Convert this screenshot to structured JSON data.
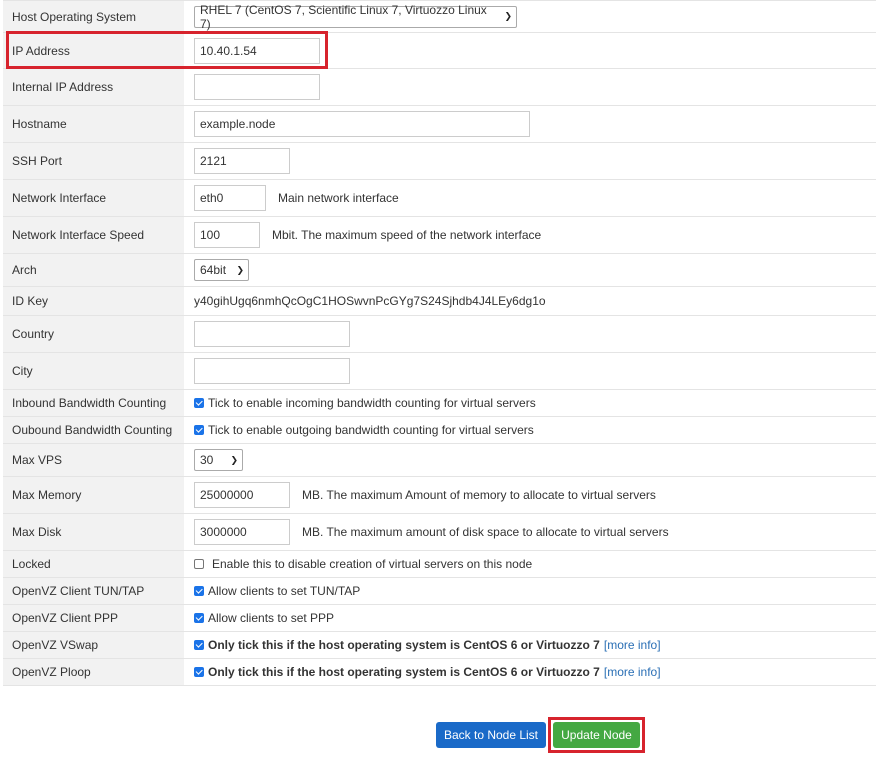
{
  "form": {
    "host_os": {
      "label": "Host Operating System",
      "value": "RHEL 7 (CentOS 7, Scientific Linux 7, Virtuozzo Linux 7)"
    },
    "ip_address": {
      "label": "IP Address",
      "value": "10.40.1.54"
    },
    "internal_ip": {
      "label": "Internal IP Address",
      "value": ""
    },
    "hostname": {
      "label": "Hostname",
      "value": "example.node"
    },
    "ssh_port": {
      "label": "SSH Port",
      "value": "2121"
    },
    "network_interface": {
      "label": "Network Interface",
      "value": "eth0",
      "help": "Main network interface"
    },
    "network_speed": {
      "label": "Network Interface Speed",
      "value": "100",
      "help": "Mbit. The maximum speed of the network interface"
    },
    "arch": {
      "label": "Arch",
      "value": "64bit"
    },
    "id_key": {
      "label": "ID Key",
      "value": "y40gihUgq6nmhQcOgC1HOSwvnPcGYg7S24Sjhdb4J4LEy6dg1o"
    },
    "country": {
      "label": "Country",
      "value": ""
    },
    "city": {
      "label": "City",
      "value": ""
    },
    "inbound_bw": {
      "label": "Inbound Bandwidth Counting",
      "checked": true,
      "text": "Tick to enable incoming bandwidth counting for virtual servers"
    },
    "outbound_bw": {
      "label": "Oubound Bandwidth Counting",
      "checked": true,
      "text": "Tick to enable outgoing bandwidth counting for virtual servers"
    },
    "max_vps": {
      "label": "Max VPS",
      "value": "30"
    },
    "max_memory": {
      "label": "Max Memory",
      "value": "25000000",
      "help": "MB. The maximum Amount of memory to allocate to virtual servers"
    },
    "max_disk": {
      "label": "Max Disk",
      "value": "3000000",
      "help": "MB. The maximum amount of disk space to allocate to virtual servers"
    },
    "locked": {
      "label": "Locked",
      "checked": false,
      "text": "Enable this to disable creation of virtual servers on this node"
    },
    "tun_tap": {
      "label": "OpenVZ Client TUN/TAP",
      "checked": true,
      "text": "Allow clients to set TUN/TAP"
    },
    "ppp": {
      "label": "OpenVZ Client PPP",
      "checked": true,
      "text": "Allow clients to set PPP"
    },
    "vswap": {
      "label": "OpenVZ VSwap",
      "checked": true,
      "text": "Only tick this if the host operating system is CentOS 6 or Virtuozzo 7",
      "link": "[more info]"
    },
    "ploop": {
      "label": "OpenVZ Ploop",
      "checked": true,
      "text": "Only tick this if the host operating system is CentOS 6 or Virtuozzo 7",
      "link": "[more info]"
    }
  },
  "buttons": {
    "back_label": "Back to Node List",
    "update_label": "Update Node",
    "back_color": "#1a6ac8",
    "update_color": "#44a842"
  },
  "highlight_color": "#d7232d",
  "icons": {
    "dropdown": "chevron-down-icon",
    "checkbox": "checkbox-icon"
  }
}
